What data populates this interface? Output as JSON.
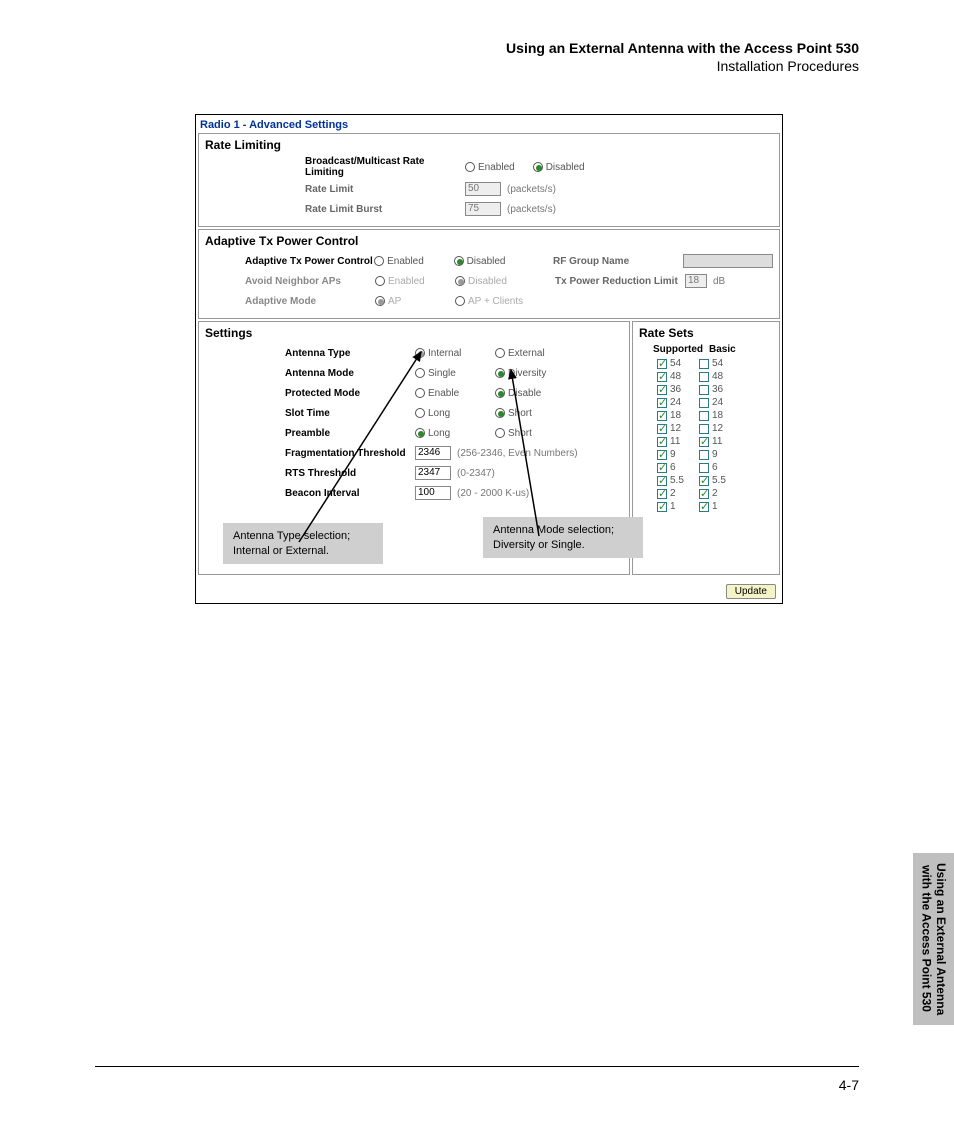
{
  "header": {
    "title": "Using an External Antenna with the Access Point 530",
    "subtitle": "Installation Procedures"
  },
  "panel": {
    "title": "Radio 1 - Advanced Settings"
  },
  "rateLimiting": {
    "heading": "Rate Limiting",
    "bmLabel": "Broadcast/Multicast Rate Limiting",
    "enabled": "Enabled",
    "disabled": "Disabled",
    "rateLimitLabel": "Rate Limit",
    "rateLimitValue": "50",
    "rateLimitUnit": "(packets/s)",
    "burstLabel": "Rate Limit Burst",
    "burstValue": "75",
    "burstUnit": "(packets/s)"
  },
  "atpc": {
    "heading": "Adaptive Tx Power Control",
    "label": "Adaptive Tx Power Control",
    "enabled": "Enabled",
    "disabled": "Disabled",
    "rfGroup": "RF Group Name",
    "avoidLabel": "Avoid Neighbor APs",
    "txRedLabel": "Tx Power Reduction Limit",
    "txRedValue": "18",
    "txRedUnit": "dB",
    "modeLabel": "Adaptive Mode",
    "ap": "AP",
    "apClients": "AP + Clients"
  },
  "settings": {
    "heading": "Settings",
    "antType": "Antenna Type",
    "internal": "Internal",
    "external": "External",
    "antMode": "Antenna Mode",
    "single": "Single",
    "diversity": "Diversity",
    "protMode": "Protected Mode",
    "enable": "Enable",
    "disable": "Disable",
    "slot": "Slot Time",
    "long": "Long",
    "short": "Short",
    "preamble": "Preamble",
    "frag": "Fragmentation Threshold",
    "fragVal": "2346",
    "fragHint": "(256-2346, Even Numbers)",
    "rts": "RTS Threshold",
    "rtsVal": "2347",
    "rtsHint": "(0-2347)",
    "beacon": "Beacon Interval",
    "beaconVal": "100",
    "beaconHint": "(20 - 2000 K-us)"
  },
  "rateSets": {
    "heading": "Rate Sets",
    "supported": "Supported",
    "basic": "Basic",
    "rows": [
      {
        "v": "54",
        "s": true,
        "b": false
      },
      {
        "v": "48",
        "s": true,
        "b": false
      },
      {
        "v": "36",
        "s": true,
        "b": false
      },
      {
        "v": "24",
        "s": true,
        "b": false
      },
      {
        "v": "18",
        "s": true,
        "b": false
      },
      {
        "v": "12",
        "s": true,
        "b": false
      },
      {
        "v": "11",
        "s": true,
        "b": true
      },
      {
        "v": "9",
        "s": true,
        "b": false
      },
      {
        "v": "6",
        "s": true,
        "b": false
      },
      {
        "v": "5.5",
        "s": true,
        "b": true
      },
      {
        "v": "2",
        "s": true,
        "b": true
      },
      {
        "v": "1",
        "s": true,
        "b": true
      }
    ]
  },
  "callouts": {
    "c1": "Antenna Type selection; Internal or External.",
    "c2": "Antenna Mode selection; Diversity or Single."
  },
  "update": "Update",
  "sideTab": {
    "l1": "Using an External Antenna",
    "l2": "with the Access Point 530"
  },
  "pageNum": "4-7"
}
